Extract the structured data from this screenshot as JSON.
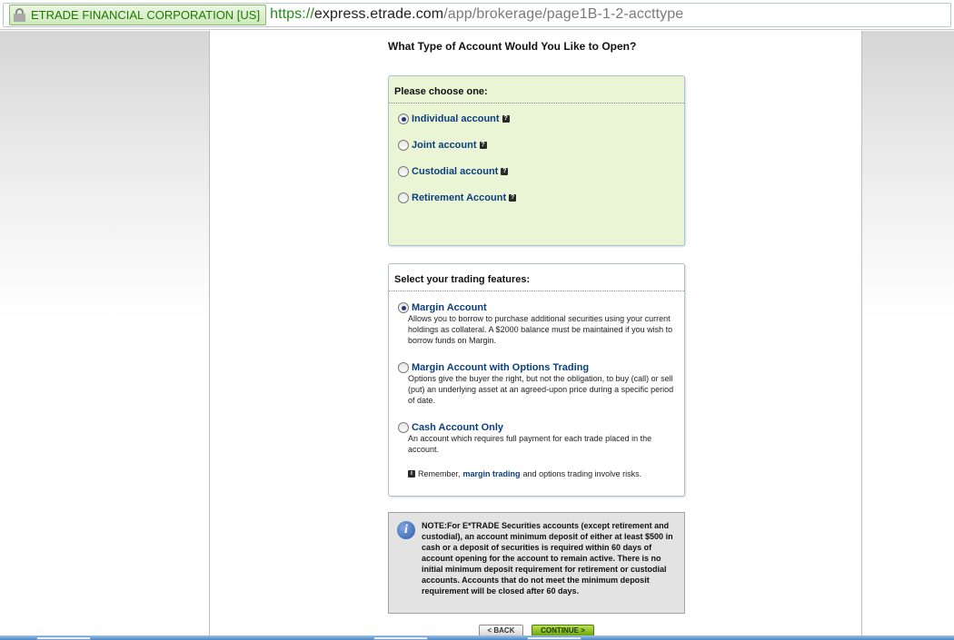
{
  "browser": {
    "cert_label": "ETRADE FINANCIAL CORPORATION [US]",
    "url_scheme": "https://",
    "url_host": "express.etrade.com",
    "url_path": "/app/brokerage/page1B-1-2-accttype"
  },
  "page": {
    "heading": "What Type of Account Would You Like to Open?"
  },
  "account_type": {
    "title": "Please choose one:",
    "options": [
      {
        "label": "Individual account",
        "selected": true
      },
      {
        "label": "Joint account",
        "selected": false
      },
      {
        "label": "Custodial account",
        "selected": false
      },
      {
        "label": "Retirement Account",
        "selected": false
      }
    ]
  },
  "trading_features": {
    "title": "Select your trading features:",
    "options": [
      {
        "label": "Margin Account",
        "selected": true,
        "description": "Allows you to borrow to purchase additional securities using your current holdings as collateral. A $2000 balance must be maintained if you wish to borrow funds on Margin."
      },
      {
        "label": "Margin Account with Options Trading",
        "selected": false,
        "description": "Options give the buyer the right, but not the obligation, to buy (call) or sell (put) an underlying asset at an agreed-upon price during a specific period of date."
      },
      {
        "label": "Cash Account Only",
        "selected": false,
        "description": "An account which requires full payment for each trade placed in the account."
      }
    ],
    "remember_prefix": "Remember,",
    "remember_link": "margin trading",
    "remember_suffix": "and options trading involve risks."
  },
  "note": {
    "text": "NOTE:For E*TRADE Securities accounts (except retirement and custodial), an account minimum deposit of either at least $500 in cash or a deposit of securities is required within 60 days of account opening for the account to remain active. There is no initial minimum deposit requirement for retirement or custodial accounts. Accounts that do not meet the minimum deposit requirement will be closed after 60 days."
  },
  "buttons": {
    "back": "< BACK",
    "continue": "CONTINUE >"
  },
  "icons": {
    "help": "help-icon",
    "info": "info-icon",
    "lock": "lock-icon"
  },
  "colors": {
    "link_blue": "#0c3f7e",
    "panel_green": "#eaf5d6",
    "continue_green": "#6ea60c"
  }
}
